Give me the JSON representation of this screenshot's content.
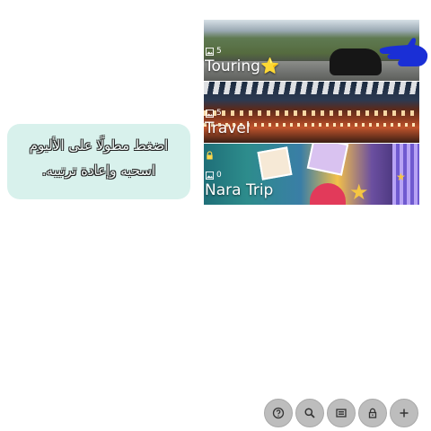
{
  "tip": {
    "line1": "اضغط مطولًا على الألبوم",
    "line2": "اسحبه وإعادة ترتيبه."
  },
  "albums": [
    {
      "title": "Touring",
      "count": "5",
      "locked": false,
      "emoji": "⭐"
    },
    {
      "title": "Travel",
      "count": "5",
      "locked": false
    },
    {
      "title": "Nara Trip",
      "count": "0",
      "locked": true
    }
  ],
  "fabs": [
    {
      "icon": "help-icon"
    },
    {
      "icon": "search-icon"
    },
    {
      "icon": "album-icon"
    },
    {
      "icon": "lock-icon"
    },
    {
      "icon": "add-icon"
    }
  ],
  "colors": {
    "tip_bg": "#d8f1ec",
    "fab_bg": "#bdbdbd",
    "pointer": "#1a2fd6"
  }
}
